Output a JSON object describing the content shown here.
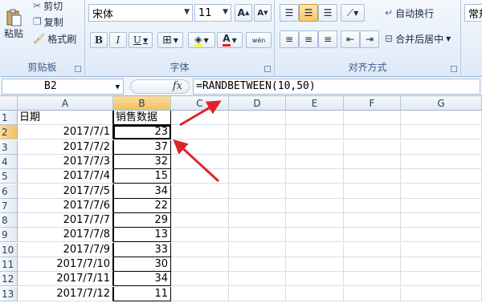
{
  "ribbon": {
    "clipboard": {
      "label": "剪贴板",
      "paste": "粘贴",
      "cut": "剪切",
      "copy": "复制",
      "format_painter": "格式刷"
    },
    "font": {
      "label": "字体",
      "family": "宋体",
      "size": "11",
      "bold": "B",
      "italic": "I",
      "underline": "U",
      "font_color_char": "A",
      "grow": "A",
      "shrink": "A",
      "wen": "wén"
    },
    "alignment": {
      "label": "对齐方式",
      "wrap": "自动换行",
      "merge": "合并后居中"
    },
    "number": {
      "format": "常规"
    }
  },
  "formula_bar": {
    "name_box": "B2",
    "fx": "fx",
    "formula": "=RANDBETWEEN(10,50)"
  },
  "sheet": {
    "columns": [
      "A",
      "B",
      "C",
      "D",
      "E",
      "F",
      "G"
    ],
    "rows": [
      "1",
      "2",
      "3",
      "4",
      "5",
      "6",
      "7",
      "8",
      "9",
      "10",
      "11",
      "12",
      "13"
    ],
    "header_a": "日期",
    "header_b": "销售数据",
    "dates": [
      "2017/7/1",
      "2017/7/2",
      "2017/7/3",
      "2017/7/4",
      "2017/7/5",
      "2017/7/6",
      "2017/7/7",
      "2017/7/8",
      "2017/7/9",
      "2017/7/10",
      "2017/7/11",
      "2017/7/12"
    ],
    "values": [
      "23",
      "37",
      "32",
      "15",
      "34",
      "22",
      "29",
      "13",
      "33",
      "30",
      "34",
      "11"
    ],
    "active_cell": "B2"
  },
  "colors": {
    "annotation_arrow": "#e0232b",
    "selected_header": "#f1c15f",
    "ribbon": "#dfe9f6"
  }
}
